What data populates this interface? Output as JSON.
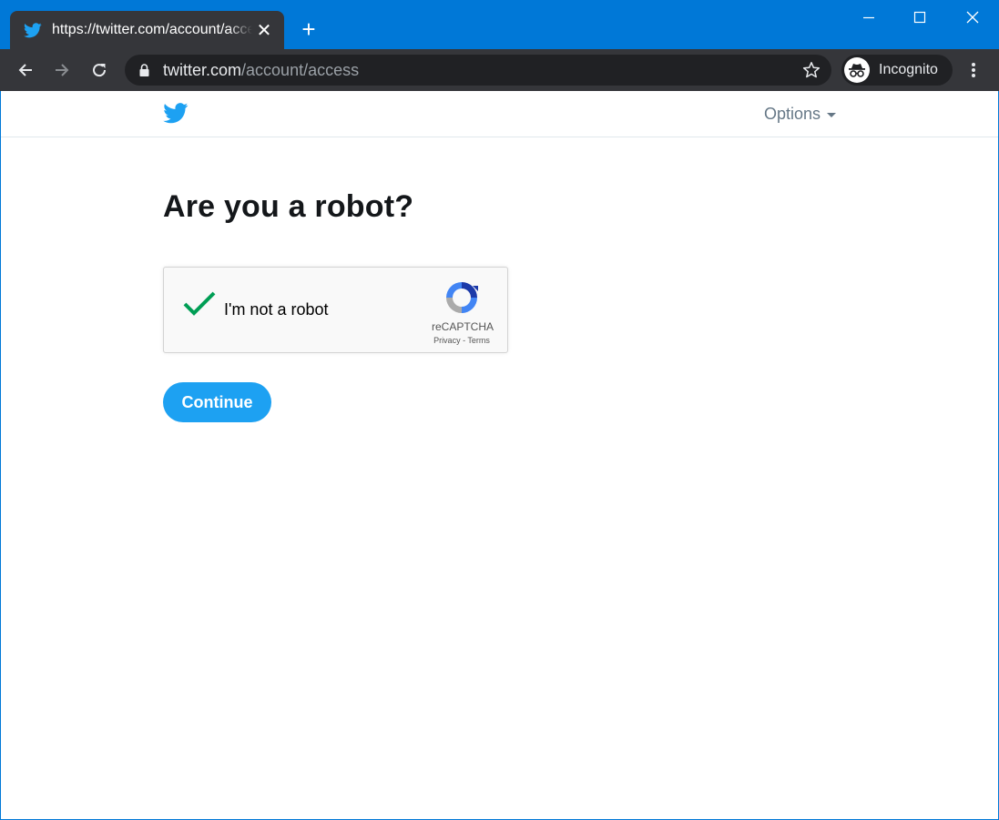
{
  "browser": {
    "tab_title": "https://twitter.com/account/access",
    "new_tab_symbol": "+",
    "tab_close_symbol": "✕",
    "url_host": "twitter.com",
    "url_path": "/account/access",
    "incognito_label": "Incognito",
    "icons": {
      "favicon": "twitter-bird-icon",
      "back": "arrow-left-icon",
      "forward": "arrow-right-icon",
      "reload": "reload-icon",
      "lock": "lock-icon",
      "bookmark": "star-icon",
      "incognito": "incognito-icon",
      "menu": "kebab-menu-icon",
      "minimize": "minimize-icon",
      "maximize": "maximize-icon",
      "close": "close-icon"
    },
    "colors": {
      "frame": "#0078d7",
      "tab": "#35363a",
      "omnibox": "#202124"
    }
  },
  "page": {
    "options_label": "Options",
    "heading": "Are you a robot?",
    "recaptcha": {
      "label": "I'm not a robot",
      "checked": true,
      "brand": "reCAPTCHA",
      "privacy": "Privacy",
      "separator": " - ",
      "terms": "Terms"
    },
    "continue_label": "Continue",
    "colors": {
      "brand_blue": "#1da1f2",
      "check_green": "#009e55",
      "heading_text": "#14171a",
      "options_text": "#657786"
    }
  }
}
